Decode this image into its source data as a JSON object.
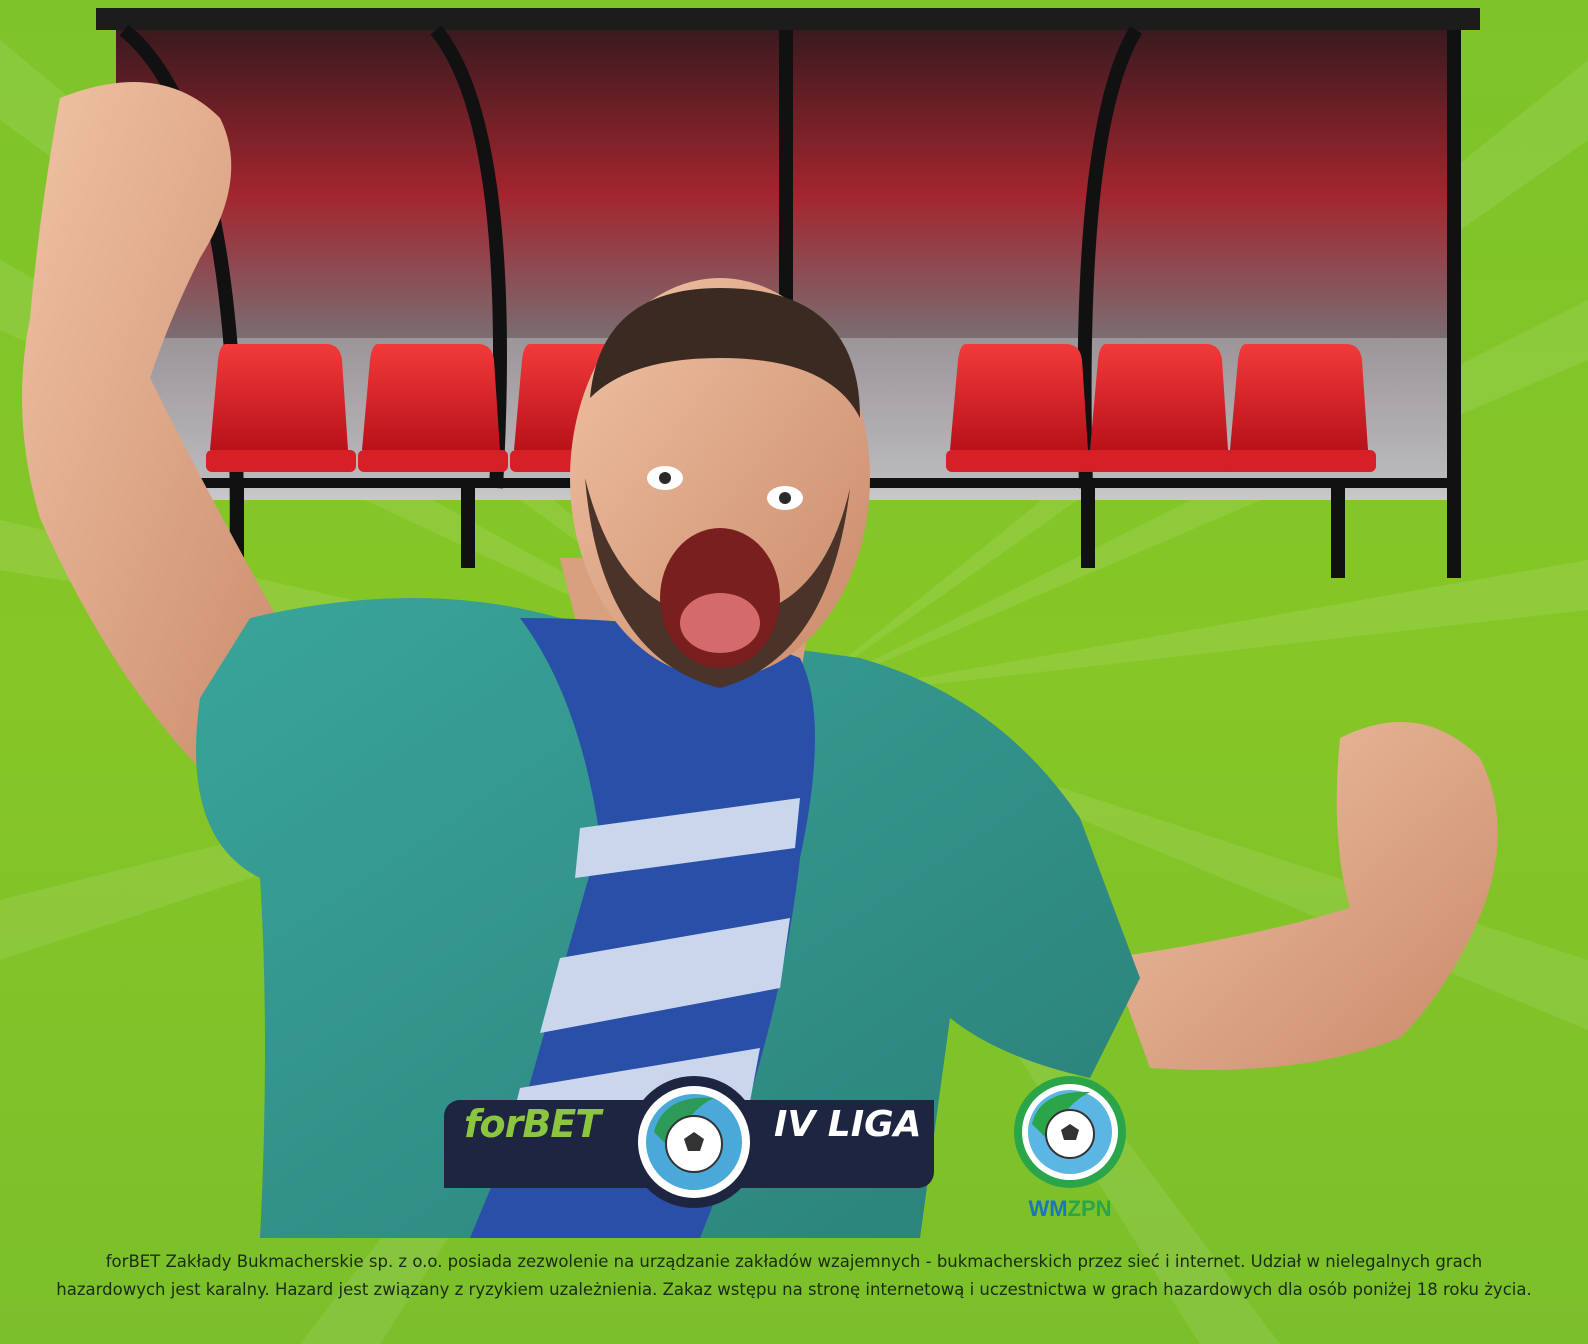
{
  "brand": {
    "name": "forBET",
    "league": "IV LIGA"
  },
  "association": {
    "prefix": "WM",
    "suffix": "ZPN"
  },
  "disclaimer": {
    "line1": "forBET Zakłady Bukmacherskie sp. z o.o. posiada zezwolenie na urządzanie zakładów wzajemnych - bukmacherskich przez sieć i internet. Udział w nielegalnych grach",
    "line2": "hazardowych jest karalny. Hazard jest związany z ryzykiem uzależnienia. Zakaz wstępu na stronę internetową i uczestnictwa w grach hazardowych dla osób poniżej 18 roku życia."
  },
  "colors": {
    "background": "#80c428",
    "logo_bar": "#1e2540",
    "logo_green": "#8cc63f",
    "seat_red": "#e3232a",
    "wm_blue": "#1a75bb",
    "zpn_green": "#2aa54a"
  }
}
